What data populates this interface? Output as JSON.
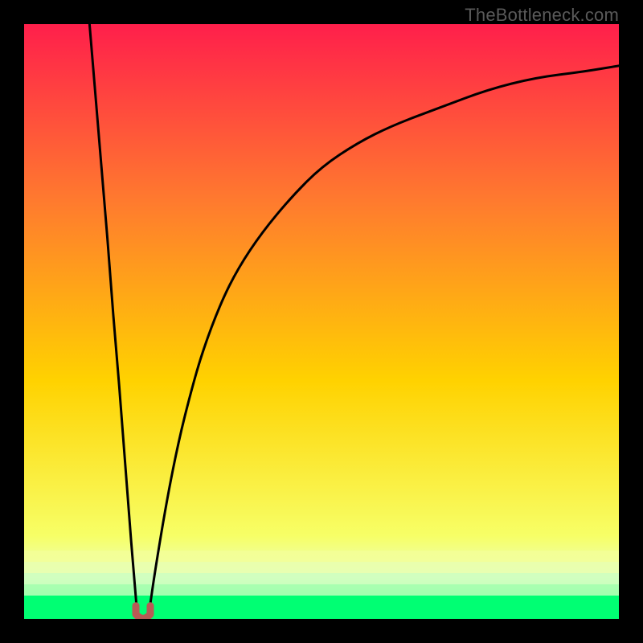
{
  "watermark": "TheBottleneck.com",
  "colors": {
    "gradient_top": "#ff1f4b",
    "gradient_mid_upper": "#ff7b2e",
    "gradient_mid": "#ffd200",
    "gradient_lower": "#f7ff66",
    "gradient_band_pale": "#eaffbf",
    "gradient_bottom": "#00ff73",
    "curve": "#000000",
    "marker_fill": "#b85a55",
    "marker_stroke": "#8f3e3a",
    "frame": "#000000"
  },
  "chart_data": {
    "type": "line",
    "title": "",
    "xlabel": "",
    "ylabel": "",
    "xlim": [
      0,
      100
    ],
    "ylim": [
      0,
      100
    ],
    "series": [
      {
        "name": "left-branch",
        "x": [
          11,
          12,
          13,
          14,
          15,
          16,
          17,
          18,
          19
        ],
        "values": [
          100,
          88,
          76,
          64,
          51,
          39,
          26,
          13,
          1
        ]
      },
      {
        "name": "right-branch",
        "x": [
          21,
          22,
          24,
          26,
          28,
          30,
          33,
          36,
          40,
          45,
          50,
          56,
          62,
          70,
          78,
          86,
          94,
          100
        ],
        "values": [
          1,
          8,
          20,
          30,
          38,
          45,
          53,
          59,
          65,
          71,
          76,
          80,
          83,
          86,
          89,
          91,
          92,
          93
        ]
      }
    ],
    "annotations": [
      {
        "name": "cusp-marker",
        "x": 20,
        "y": 0.5,
        "shape": "u-blob"
      }
    ],
    "gradient_bands_y": [
      0,
      4,
      8,
      12,
      85,
      100
    ],
    "grid": false,
    "legend": false
  }
}
